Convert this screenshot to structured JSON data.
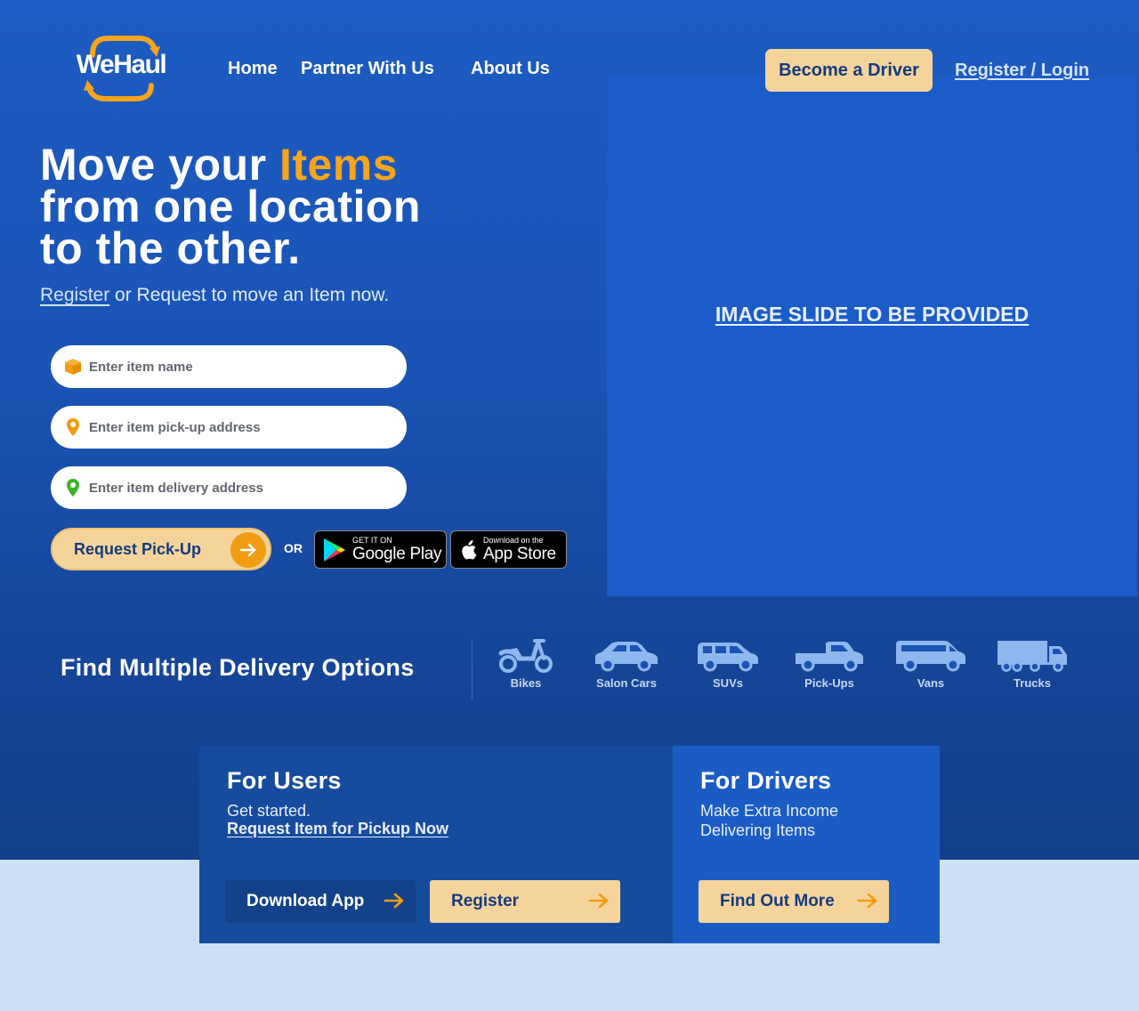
{
  "header": {
    "logo_text": "WeHaul",
    "nav": {
      "home": "Home",
      "partner": "Partner With Us",
      "about": "About Us"
    },
    "become_driver": "Become a Driver",
    "register_login": "Register / Login"
  },
  "hero": {
    "headline_part1": "Move your ",
    "headline_accent": "Items",
    "headline_line2": "from one location",
    "headline_line3": "to the other.",
    "sub_register": "Register",
    "sub_rest": " or Request to move an Item now.",
    "slide_placeholder": "IMAGE SLIDE TO BE PROVIDED"
  },
  "form": {
    "item_name_placeholder": "Enter item name",
    "pickup_placeholder": "Enter item pick-up address",
    "delivery_placeholder": "Enter item delivery address",
    "request_button": "Request Pick-Up",
    "or": "OR",
    "google_play_small": "GET IT ON",
    "google_play_big": "Google Play",
    "app_store_small": "Download on the",
    "app_store_big": "App Store"
  },
  "delivery_options": {
    "title": "Find Multiple Delivery Options",
    "vehicles": [
      "Bikes",
      "Salon Cars",
      "SUVs",
      "Pick-Ups",
      "Vans",
      "Trucks"
    ]
  },
  "users_card": {
    "title": "For Users",
    "text": "Get started.",
    "link": "Request Item for Pickup Now",
    "download_button": "Download App",
    "register_button": "Register"
  },
  "drivers_card": {
    "title": "For Drivers",
    "text_line1": "Make Extra Income",
    "text_line2": "Delivering Items",
    "button": "Find Out More"
  },
  "colors": {
    "primary_blue": "#1d5cc2",
    "accent_orange": "#f6a51d",
    "button_cream": "#f5d49c",
    "dark_navy": "#153b7e"
  }
}
